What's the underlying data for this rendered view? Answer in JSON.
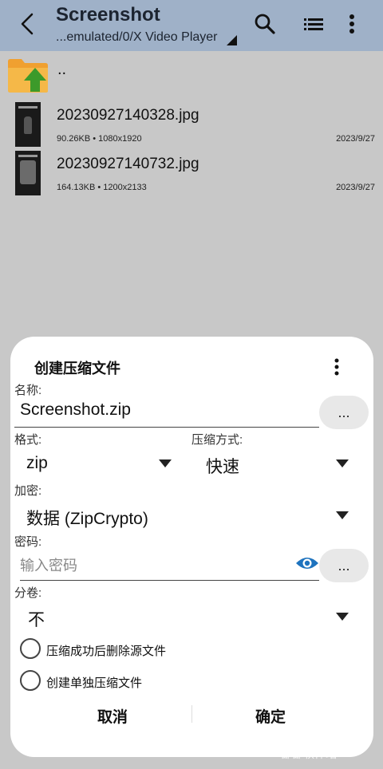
{
  "topbar": {
    "title": "Screenshot",
    "path": "...emulated/0/X Video Player"
  },
  "icons": {
    "back": "arrow-left-icon",
    "search": "search-icon",
    "view": "list-view-icon",
    "menu": "more-vert-icon",
    "folder_up": "folder-up-icon"
  },
  "file_list": {
    "parent_label": "..",
    "files": [
      {
        "name": "20230927140328.jpg",
        "size": "90.26KB",
        "dimensions": "1080x1920",
        "date": "2023/9/27"
      },
      {
        "name": "20230927140732.jpg",
        "size": "164.13KB",
        "dimensions": "1200x2133",
        "date": "2023/9/27"
      }
    ]
  },
  "dialog": {
    "title": "创建压缩文件",
    "name_label": "名称:",
    "name_value": "Screenshot.zip",
    "browse_label": "...",
    "format_label": "格式:",
    "format_value": "zip",
    "method_label": "压缩方式:",
    "method_value": "快速",
    "encryption_label": "加密:",
    "encryption_value": "数据 (ZipCrypto)",
    "password_label": "密码:",
    "password_placeholder": "输入密码",
    "password_more_label": "...",
    "split_label": "分卷:",
    "split_value": "不",
    "option_delete_source": "压缩成功后删除源文件",
    "option_separate": "创建单独压缩文件",
    "cancel_label": "取消",
    "ok_label": "确定"
  },
  "watermark": "鄱鄱软件站",
  "colors": {
    "topbar_bg": "#9fb1c8",
    "background": "#c8c8c8",
    "dialog_bg": "#ffffff",
    "eye_icon": "#1e73be",
    "folder": "#f0a030",
    "folder_arrow": "#3c9a2a"
  }
}
